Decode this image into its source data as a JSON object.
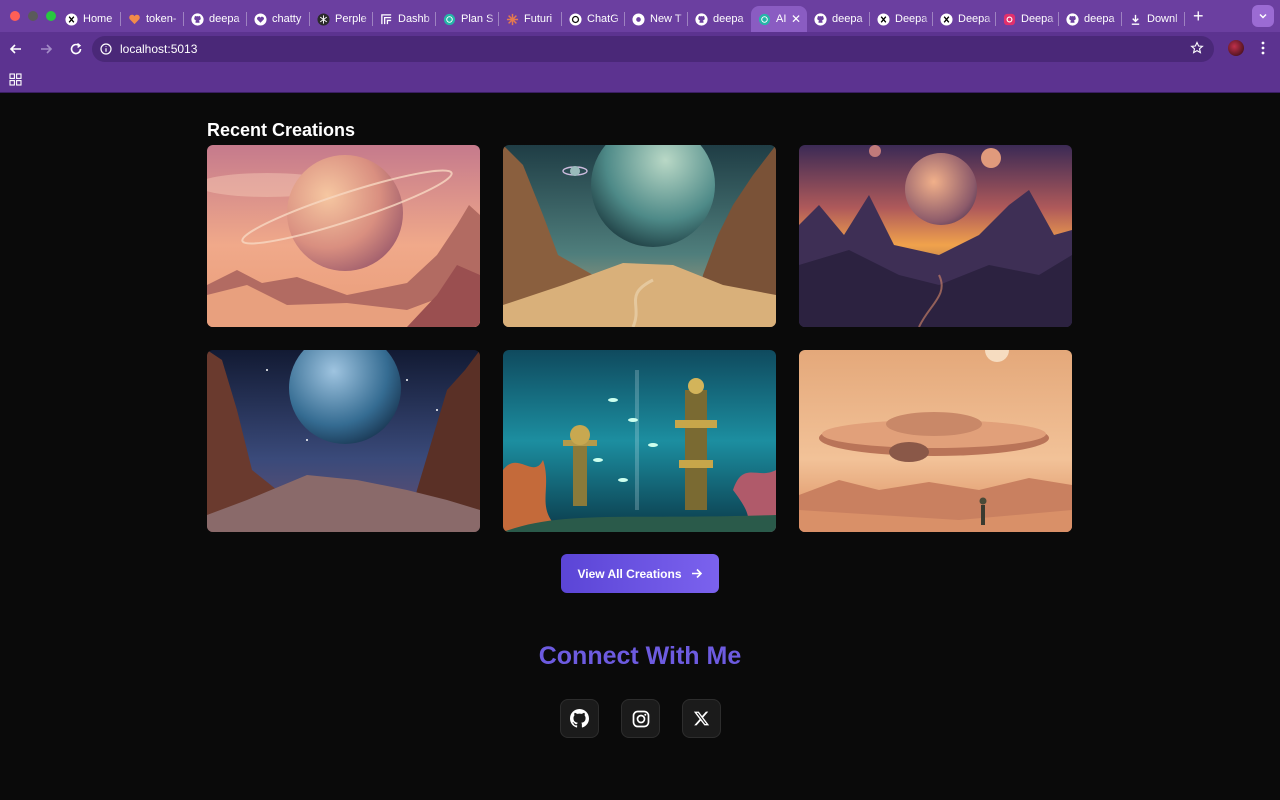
{
  "browser": {
    "tabs": [
      {
        "label": "Home",
        "icon": "x-logo-icon"
      },
      {
        "label": "token-",
        "icon": "heart-icon"
      },
      {
        "label": "deepa",
        "icon": "github-icon"
      },
      {
        "label": "chatty",
        "icon": "heart-outline-icon"
      },
      {
        "label": "Perple",
        "icon": "perplexity-icon"
      },
      {
        "label": "Dashb",
        "icon": "dashboard-icon"
      },
      {
        "label": "Plan S",
        "icon": "globe-icon"
      },
      {
        "label": "Futuri",
        "icon": "sparkle-icon"
      },
      {
        "label": "ChatG",
        "icon": "openai-icon"
      },
      {
        "label": "New T",
        "icon": "chrome-icon"
      },
      {
        "label": "deepa",
        "icon": "github-icon"
      },
      {
        "label": "AI",
        "icon": "globe-icon",
        "active": true
      },
      {
        "label": "deepa",
        "icon": "github-icon"
      },
      {
        "label": "Deepa",
        "icon": "x-logo-icon"
      },
      {
        "label": "Deepa",
        "icon": "x-logo-icon"
      },
      {
        "label": "Deepa",
        "icon": "instagram-icon"
      },
      {
        "label": "deepa",
        "icon": "github-icon"
      },
      {
        "label": "Downl",
        "icon": "download-icon"
      }
    ],
    "url": "localhost:5013"
  },
  "page": {
    "section_title": "Recent Creations",
    "view_all_label": "View All Creations",
    "connect_title": "Connect With Me",
    "socials": [
      "github-icon",
      "instagram-icon",
      "x-logo-icon"
    ]
  },
  "colors": {
    "tabbar": "#6b3fa0",
    "toolbar": "#5c3390",
    "background": "#0a0a0a",
    "accent": "#6d5be0",
    "button": "#6651e2"
  }
}
